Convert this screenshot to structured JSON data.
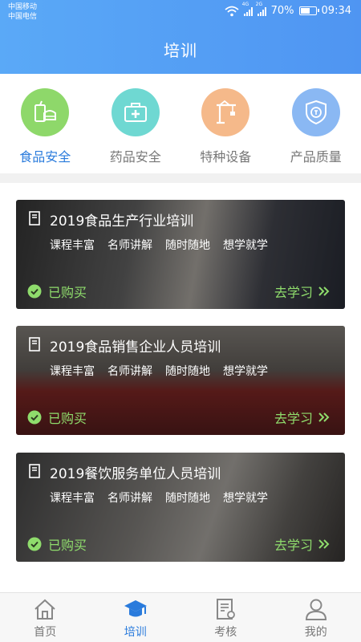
{
  "status_bar": {
    "carrier1": "中国移动",
    "carrier2": "中国电信",
    "net1": "4G",
    "net2": "2G",
    "battery": "70%",
    "battery_level": 0.7,
    "time": "09:34"
  },
  "header": {
    "title": "培训"
  },
  "categories": [
    {
      "label": "食品安全",
      "icon": "food-safety-icon",
      "color": "#8ed86a",
      "active": true
    },
    {
      "label": "药品安全",
      "icon": "medical-kit-icon",
      "color": "#6fd8d2",
      "active": false
    },
    {
      "label": "特种设备",
      "icon": "crane-icon",
      "color": "#f5b98a",
      "active": false
    },
    {
      "label": "产品质量",
      "icon": "quality-shield-icon",
      "color": "#8ab8f3",
      "active": false
    }
  ],
  "courses": [
    {
      "title": "2019食品生产行业培训",
      "tags": [
        "课程丰富",
        "名师讲解",
        "随时随地",
        "想学就学"
      ],
      "status": "已购买",
      "action": "去学习"
    },
    {
      "title": "2019食品销售企业人员培训",
      "tags": [
        "课程丰富",
        "名师讲解",
        "随时随地",
        "想学就学"
      ],
      "status": "已购买",
      "action": "去学习"
    },
    {
      "title": "2019餐饮服务单位人员培训",
      "tags": [
        "课程丰富",
        "名师讲解",
        "随时随地",
        "想学就学"
      ],
      "status": "已购买",
      "action": "去学习"
    }
  ],
  "tabbar": [
    {
      "label": "首页",
      "icon": "home-icon",
      "active": false
    },
    {
      "label": "培训",
      "icon": "graduation-cap-icon",
      "active": true
    },
    {
      "label": "考核",
      "icon": "exam-doc-icon",
      "active": false
    },
    {
      "label": "我的",
      "icon": "user-icon",
      "active": false
    }
  ],
  "colors": {
    "accent": "#2a7bdc",
    "header": "#5aa9f7",
    "bought": "#8fdc6c"
  }
}
